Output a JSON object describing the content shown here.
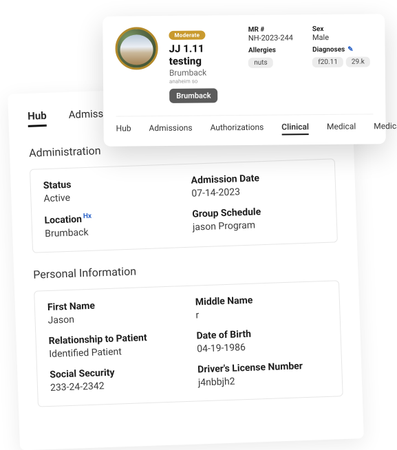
{
  "back": {
    "tabs": {
      "hub": "Hub",
      "admissions": "Admissi"
    },
    "admin_title": "Administration",
    "status_label": "Status",
    "status": "Active",
    "location_label": "Location",
    "location_hx": "Hx",
    "location": "Brumback",
    "adm_date_label": "Admission Date",
    "adm_date": "07-14-2023",
    "sched_label": "Group Schedule",
    "sched": "jason Program",
    "pi_title": "Personal Information",
    "first_label": "First Name",
    "first": "Jason",
    "middle_label": "Middle Name",
    "middle": "r",
    "dob_label": "Date of Birth",
    "dob": "04-19-1986",
    "dl_label": "Driver's License Number",
    "dl": "j4nbbjh2",
    "rel_label": "Relationship to Patient",
    "rel": "Identified Patient",
    "ssn_label": "Social Security",
    "ssn": "233-24-2342"
  },
  "front": {
    "badge": "Moderate",
    "name": "JJ 1.11 testing",
    "loc": "Brumback",
    "sub": "anaheim so",
    "chip": "Brumback",
    "mr_label": "MR #",
    "mr": "NH-2023-244",
    "sex_label": "Sex",
    "sex": "Male",
    "allergy_label": "Allergies",
    "allergy": "nuts",
    "diag_label": "Diagnoses",
    "diag1": "f20.11",
    "diag2": "29.k",
    "tabs": {
      "hub": "Hub",
      "admissions": "Admissions",
      "auth": "Authorizations",
      "clinical": "Clinical",
      "medical": "Medical",
      "meds": "Medications"
    }
  }
}
